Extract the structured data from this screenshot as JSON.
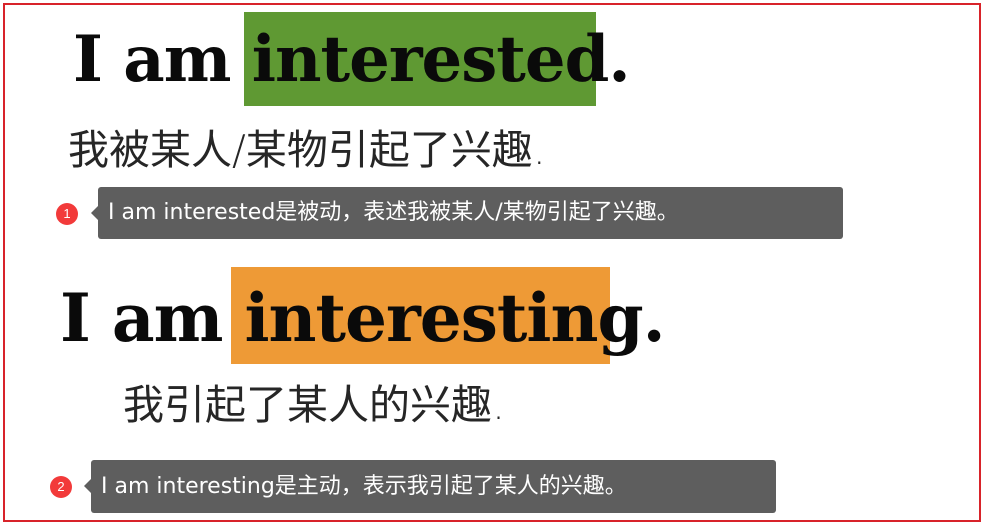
{
  "colors": {
    "border": "#d8232a",
    "highlight_interested": "#5f9933",
    "highlight_interesting": "#ee9a36",
    "badge": "#f23a3a",
    "tooltip_bg": "#5e5e5e"
  },
  "example1": {
    "prefix": "I am ",
    "highlighted_word": "interested",
    "suffix": ".",
    "translation": "我被某人/某物引起了兴趣."
  },
  "example2": {
    "prefix": "I am ",
    "highlighted_word": "interesting",
    "suffix": ".",
    "translation": "我引起了某人的兴趣."
  },
  "notes": [
    {
      "number": "1",
      "text": "I am interested是被动，表述我被某人/某物引起了兴趣。"
    },
    {
      "number": "2",
      "text": "I am interesting是主动，表示我引起了某人的兴趣。"
    }
  ]
}
